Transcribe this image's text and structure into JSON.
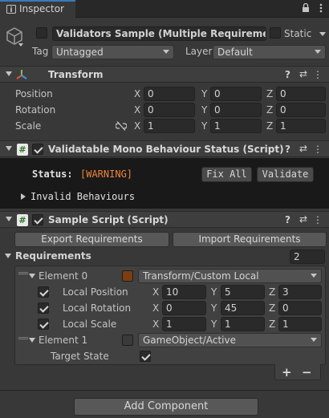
{
  "tab": {
    "label": "Inspector"
  },
  "gameobject": {
    "name": "Validators Sample (Multiple Requirements)",
    "static_label": "Static",
    "tag_label": "Tag",
    "tag_value": "Untagged",
    "layer_label": "Layer",
    "layer_value": "Default"
  },
  "transform": {
    "title": "Transform",
    "rows": [
      {
        "label": "Position",
        "x": "0",
        "y": "0",
        "z": "0"
      },
      {
        "label": "Rotation",
        "x": "0",
        "y": "0",
        "z": "0"
      },
      {
        "label": "Scale",
        "x": "1",
        "y": "1",
        "z": "1"
      }
    ]
  },
  "axes": {
    "x": "X",
    "y": "Y",
    "z": "Z"
  },
  "validator": {
    "title": "Validatable Mono Behaviour Status (Script)",
    "status_label": "Status:",
    "status_value": "[WARNING]",
    "fix_all": "Fix All",
    "validate": "Validate",
    "invalid_behaviours": "Invalid Behaviours"
  },
  "sample": {
    "title": "Sample Script (Script)",
    "export": "Export Requirements",
    "import": "Import Requirements",
    "requirements_label": "Requirements",
    "requirements_count": "2",
    "element0": {
      "label": "Element 0",
      "type": "Transform/Custom Local",
      "local_position": {
        "label": "Local Position",
        "x": "10",
        "y": "5",
        "z": "3"
      },
      "local_rotation": {
        "label": "Local Rotation",
        "x": "0",
        "y": "45",
        "z": "0"
      },
      "local_scale": {
        "label": "Local Scale",
        "x": "1",
        "y": "1",
        "z": "1"
      }
    },
    "element1": {
      "label": "Element 1",
      "type": "GameObject/Active",
      "target_state_label": "Target State"
    },
    "add": "+",
    "remove": "−"
  },
  "add_component": "Add Component",
  "colors": {
    "background": "#383838",
    "warning": "#f0843a",
    "tab_accent": "#3a79bb",
    "element0_swatch": "#7a3e12"
  }
}
